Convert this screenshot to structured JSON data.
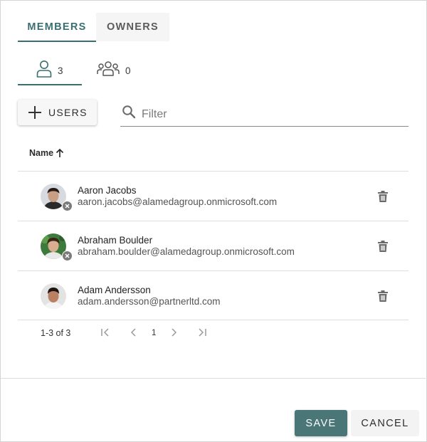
{
  "tabs": {
    "members": "MEMBERS",
    "owners": "OWNERS"
  },
  "subtabs": {
    "users": {
      "icon": "user-icon",
      "count": "3"
    },
    "groups": {
      "icon": "group-icon",
      "count": "0"
    }
  },
  "toolbar": {
    "add_users_label": "USERS",
    "filter_placeholder": "Filter"
  },
  "table": {
    "column_name": "Name",
    "sort": "ascending",
    "rows": [
      {
        "name": "Aaron Jacobs",
        "email": "aaron.jacobs@alamedagroup.onmicrosoft.com",
        "remove_badge": true
      },
      {
        "name": "Abraham Boulder",
        "email": "abraham.boulder@alamedagroup.onmicrosoft.com",
        "remove_badge": true
      },
      {
        "name": "Adam Andersson",
        "email": "adam.andersson@partnerltd.com",
        "remove_badge": false
      }
    ]
  },
  "pagination": {
    "range": "1-3 of 3",
    "page": "1"
  },
  "footer": {
    "save": "SAVE",
    "cancel": "CANCEL"
  },
  "colors": {
    "accent": "#3c6e71",
    "save_bg": "#4a7678",
    "cancel_bg": "#f3f3f3"
  }
}
